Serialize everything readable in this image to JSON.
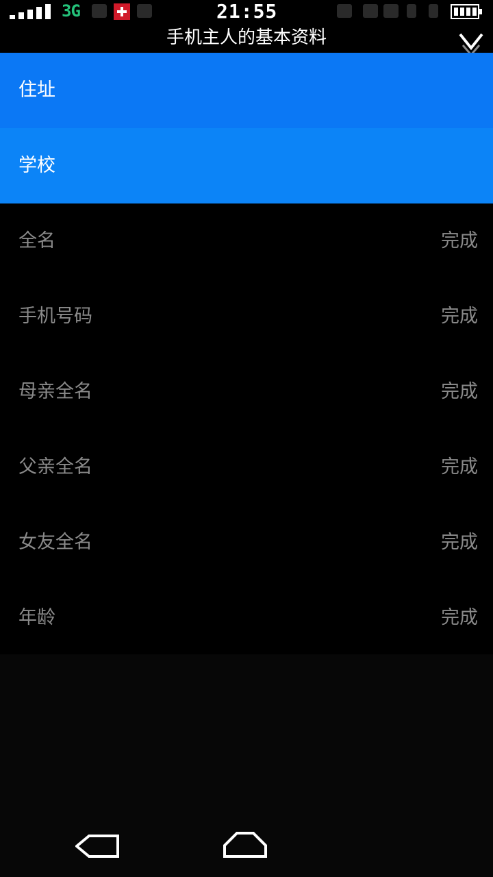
{
  "status_bar": {
    "network": "3G",
    "time": "21:55",
    "icons": [
      "signal-icon",
      "flag-icon",
      "battery-icon"
    ],
    "colors": {
      "network": "#24c27a",
      "flag": "#d11a2a"
    }
  },
  "header": {
    "title": "手机主人的基本资料",
    "collapse_icon": "chevron-down-icon"
  },
  "list": {
    "items": [
      {
        "label": "住址",
        "status": ""
      },
      {
        "label": "学校",
        "status": ""
      },
      {
        "label": "全名",
        "status": "完成"
      },
      {
        "label": "手机号码",
        "status": "完成"
      },
      {
        "label": "母亲全名",
        "status": "完成"
      },
      {
        "label": "父亲全名",
        "status": "完成"
      },
      {
        "label": "女友全名",
        "status": "完成"
      },
      {
        "label": "年龄",
        "status": "完成"
      }
    ],
    "colors": {
      "highlight_1": "#0b78f5",
      "highlight_2": "#0c84f7",
      "muted_text": "#8a8a8a"
    }
  },
  "nav_bar": {
    "icons": [
      "back-icon",
      "home-icon"
    ]
  }
}
